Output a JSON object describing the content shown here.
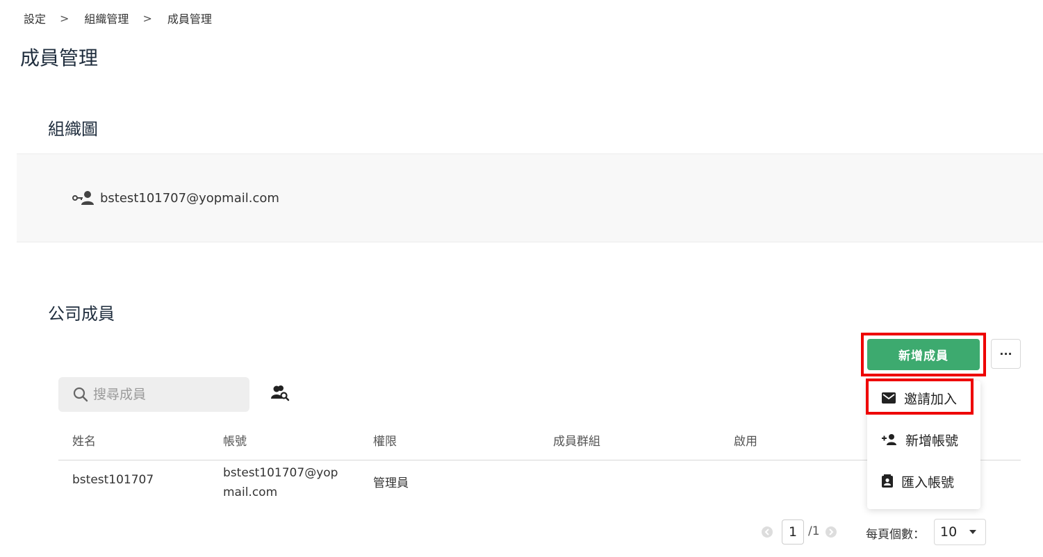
{
  "breadcrumb": {
    "items": [
      "設定",
      "組織管理",
      "成員管理"
    ],
    "separator": ">"
  },
  "page_title": "成員管理",
  "org_chart": {
    "title": "組織圖",
    "root_node": {
      "icon": "admin-key-person-icon",
      "label": "bstest101707@yopmail.com"
    }
  },
  "members": {
    "title": "公司成員",
    "add_button_label": "新增成員",
    "more_button_label": "···",
    "search": {
      "placeholder": "搜尋成員",
      "value": ""
    },
    "dropdown": {
      "items": [
        {
          "icon": "mail-icon",
          "label": "邀請加入"
        },
        {
          "icon": "person-add-icon",
          "label": "新增帳號"
        },
        {
          "icon": "contact-card-icon",
          "label": "匯入帳號"
        }
      ]
    },
    "table": {
      "columns": [
        "姓名",
        "帳號",
        "權限",
        "成員群組",
        "啟用"
      ],
      "rows": [
        {
          "name": "bstest101707",
          "account_line1": "bstest101707@yop",
          "account_line2": "mail.com",
          "role": "管理員",
          "group": "",
          "enabled": ""
        }
      ]
    },
    "pagination": {
      "current_page": "1",
      "total_pages": "/1",
      "per_page_label": "每頁個數：",
      "per_page_value": "10"
    }
  },
  "colors": {
    "primary": "#3daa6f",
    "highlight": "#ee0000",
    "panel_bg": "#f8f8f8"
  }
}
